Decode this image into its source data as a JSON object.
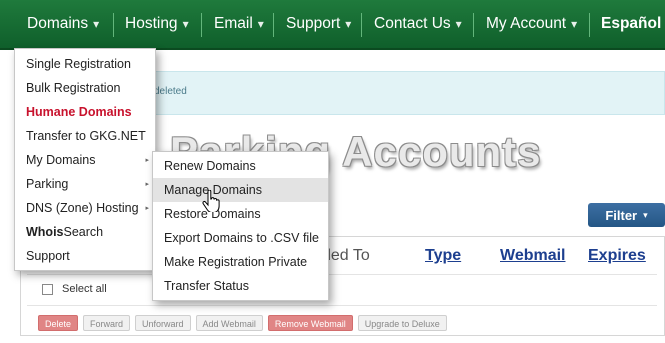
{
  "nav": {
    "items": [
      {
        "label": "Domains",
        "caret": true
      },
      {
        "label": "Hosting",
        "caret": true
      },
      {
        "label": "Email",
        "caret": true
      },
      {
        "label": "Support",
        "caret": true
      },
      {
        "label": "Contact Us",
        "caret": true
      },
      {
        "label": "My Account",
        "caret": true
      },
      {
        "label": "Español",
        "caret": false
      }
    ],
    "caret_glyph": "▾",
    "background_color": "#167034"
  },
  "notice": {
    "text": "deleted"
  },
  "page": {
    "title": "Parking Accounts"
  },
  "filter": {
    "label": "Filter",
    "caret": "▾"
  },
  "table": {
    "headers": {
      "forwarded_to": "ded To",
      "type": "Type",
      "webmail": "Webmail",
      "expires": "Expires"
    },
    "select_all": "Select all",
    "actions": [
      "Delete",
      "Forward",
      "Unforward",
      "Add Webmail",
      "Remove Webmail",
      "Upgrade to Deluxe"
    ]
  },
  "domains_menu": {
    "items": [
      {
        "label": "Single Registration"
      },
      {
        "label": "Bulk Registration"
      },
      {
        "label": "Humane Domains",
        "style": "red"
      },
      {
        "label": "Transfer to GKG.NET"
      },
      {
        "label": "My Domains",
        "submenu": true
      },
      {
        "label": "Parking",
        "submenu": true
      },
      {
        "label": "DNS (Zone) Hosting",
        "submenu": true
      },
      {
        "label": "Whois Search",
        "bold_part": "Whois",
        "rest": " Search"
      },
      {
        "label": "Support"
      }
    ],
    "arrow_glyph": "▸"
  },
  "my_domains_submenu": {
    "items": [
      {
        "label": "Renew Domains"
      },
      {
        "label": "Manage Domains",
        "hovered": true
      },
      {
        "label": "Restore Domains"
      },
      {
        "label": "Export Domains to .CSV file"
      },
      {
        "label": "Make Registration Private"
      },
      {
        "label": "Transfer Status"
      }
    ]
  },
  "colors": {
    "accent_red": "#c8122d",
    "link_blue": "#1d3f8f",
    "filter_blue": "#2d5f92",
    "notice_bg": "#e2f3f6"
  },
  "icons": {
    "cursor": "hand-pointer-icon"
  }
}
